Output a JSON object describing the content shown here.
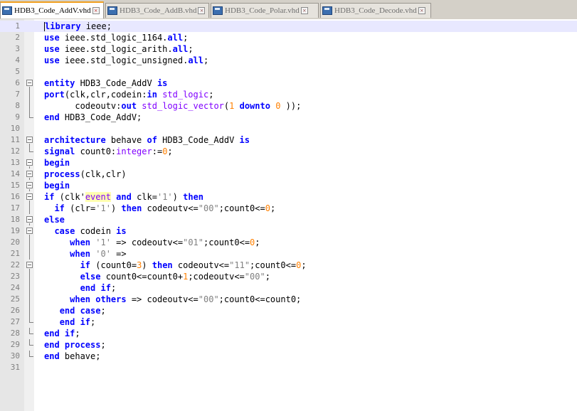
{
  "tabs": [
    {
      "label": "HDB3_Code_AddV.vhd",
      "active": true
    },
    {
      "label": "HDB3_Code_AddB.vhd",
      "active": false
    },
    {
      "label": "HDB3_Code_Polar.vhd",
      "active": false
    },
    {
      "label": "HDB3_Code_Decode.vhd",
      "active": false
    }
  ],
  "line_numbers": [
    "1",
    "2",
    "3",
    "4",
    "5",
    "6",
    "7",
    "8",
    "9",
    "10",
    "11",
    "12",
    "13",
    "14",
    "15",
    "16",
    "17",
    "18",
    "19",
    "20",
    "21",
    "22",
    "23",
    "24",
    "25",
    "26",
    "27",
    "28",
    "29",
    "30",
    "31"
  ],
  "code_lines": [
    [
      {
        "c": "k",
        "v": "library"
      },
      {
        "v": " ieee;"
      }
    ],
    [
      {
        "c": "k",
        "v": "use"
      },
      {
        "v": " ieee.std_logic_1164."
      },
      {
        "c": "k",
        "v": "all"
      },
      {
        "v": ";"
      }
    ],
    [
      {
        "c": "k",
        "v": "use"
      },
      {
        "v": " ieee.std_logic_arith."
      },
      {
        "c": "k",
        "v": "all"
      },
      {
        "v": ";"
      }
    ],
    [
      {
        "c": "k",
        "v": "use"
      },
      {
        "v": " ieee.std_logic_unsigned."
      },
      {
        "c": "k",
        "v": "all"
      },
      {
        "v": ";"
      }
    ],
    [],
    [
      {
        "c": "k",
        "v": "entity"
      },
      {
        "v": " HDB3_Code_AddV "
      },
      {
        "c": "k",
        "v": "is"
      }
    ],
    [
      {
        "c": "k",
        "v": "port"
      },
      {
        "v": "(clk,clr,codein:"
      },
      {
        "c": "k",
        "v": "in"
      },
      {
        "v": " "
      },
      {
        "c": "t",
        "v": "std_logic"
      },
      {
        "v": ";"
      }
    ],
    [
      {
        "v": "      codeoutv:"
      },
      {
        "c": "k",
        "v": "out"
      },
      {
        "v": " "
      },
      {
        "c": "t",
        "v": "std_logic_vector"
      },
      {
        "v": "("
      },
      {
        "c": "n",
        "v": "1"
      },
      {
        "v": " "
      },
      {
        "c": "k",
        "v": "downto"
      },
      {
        "v": " "
      },
      {
        "c": "n",
        "v": "0"
      },
      {
        "v": " ));"
      }
    ],
    [
      {
        "c": "k",
        "v": "end"
      },
      {
        "v": " HDB3_Code_AddV;"
      }
    ],
    [],
    [
      {
        "c": "k",
        "v": "architecture"
      },
      {
        "v": " behave "
      },
      {
        "c": "k",
        "v": "of"
      },
      {
        "v": " HDB3_Code_AddV "
      },
      {
        "c": "k",
        "v": "is"
      }
    ],
    [
      {
        "c": "k",
        "v": "signal"
      },
      {
        "v": " count0:"
      },
      {
        "c": "t",
        "v": "integer"
      },
      {
        "v": ":="
      },
      {
        "c": "n",
        "v": "0"
      },
      {
        "v": ";"
      }
    ],
    [
      {
        "c": "k",
        "v": "begin"
      }
    ],
    [
      {
        "c": "k",
        "v": "process"
      },
      {
        "v": "(clk,clr)"
      }
    ],
    [
      {
        "c": "k",
        "v": "begin"
      }
    ],
    [
      {
        "c": "k",
        "v": "if"
      },
      {
        "v": " (clk'"
      },
      {
        "c": "hl",
        "v": "event"
      },
      {
        "v": " "
      },
      {
        "c": "k",
        "v": "and"
      },
      {
        "v": " clk="
      },
      {
        "c": "s",
        "v": "'1'"
      },
      {
        "v": ") "
      },
      {
        "c": "k",
        "v": "then"
      }
    ],
    [
      {
        "v": "  "
      },
      {
        "c": "k",
        "v": "if"
      },
      {
        "v": " (clr="
      },
      {
        "c": "s",
        "v": "'1'"
      },
      {
        "v": ") "
      },
      {
        "c": "k",
        "v": "then"
      },
      {
        "v": " codeoutv<="
      },
      {
        "c": "s",
        "v": "\"00\""
      },
      {
        "v": ";count0<="
      },
      {
        "c": "n",
        "v": "0"
      },
      {
        "v": ";"
      }
    ],
    [
      {
        "c": "k",
        "v": "else"
      }
    ],
    [
      {
        "v": "  "
      },
      {
        "c": "k",
        "v": "case"
      },
      {
        "v": " codein "
      },
      {
        "c": "k",
        "v": "is"
      }
    ],
    [
      {
        "v": "     "
      },
      {
        "c": "k",
        "v": "when"
      },
      {
        "v": " "
      },
      {
        "c": "s",
        "v": "'1'"
      },
      {
        "v": " => codeoutv<="
      },
      {
        "c": "s",
        "v": "\"01\""
      },
      {
        "v": ";count0<="
      },
      {
        "c": "n",
        "v": "0"
      },
      {
        "v": ";"
      }
    ],
    [
      {
        "v": "     "
      },
      {
        "c": "k",
        "v": "when"
      },
      {
        "v": " "
      },
      {
        "c": "s",
        "v": "'0'"
      },
      {
        "v": " =>"
      }
    ],
    [
      {
        "v": "       "
      },
      {
        "c": "k",
        "v": "if"
      },
      {
        "v": " (count0="
      },
      {
        "c": "n",
        "v": "3"
      },
      {
        "v": ") "
      },
      {
        "c": "k",
        "v": "then"
      },
      {
        "v": " codeoutv<="
      },
      {
        "c": "s",
        "v": "\"11\""
      },
      {
        "v": ";count0<="
      },
      {
        "c": "n",
        "v": "0"
      },
      {
        "v": ";"
      }
    ],
    [
      {
        "v": "       "
      },
      {
        "c": "k",
        "v": "else"
      },
      {
        "v": " count0<=count0+"
      },
      {
        "c": "n",
        "v": "1"
      },
      {
        "v": ";codeoutv<="
      },
      {
        "c": "s",
        "v": "\"00\""
      },
      {
        "v": ";"
      }
    ],
    [
      {
        "v": "       "
      },
      {
        "c": "k",
        "v": "end if"
      },
      {
        "v": ";"
      }
    ],
    [
      {
        "v": "     "
      },
      {
        "c": "k",
        "v": "when others"
      },
      {
        "v": " => codeoutv<="
      },
      {
        "c": "s",
        "v": "\"00\""
      },
      {
        "v": ";count0<=count0;"
      }
    ],
    [
      {
        "v": "   "
      },
      {
        "c": "k",
        "v": "end case"
      },
      {
        "v": ";"
      }
    ],
    [
      {
        "v": "   "
      },
      {
        "c": "k",
        "v": "end if"
      },
      {
        "v": ";"
      }
    ],
    [
      {
        "c": "k",
        "v": "end if"
      },
      {
        "v": ";"
      }
    ],
    [
      {
        "c": "k",
        "v": "end process"
      },
      {
        "v": ";"
      }
    ],
    [
      {
        "c": "k",
        "v": "end"
      },
      {
        "v": " behave;"
      }
    ],
    []
  ],
  "fold_markers": [
    "",
    "",
    "",
    "",
    "",
    "box",
    "line",
    "line",
    "end",
    "",
    "box",
    "end",
    "box",
    "box",
    "box",
    "box",
    "line",
    "box",
    "box",
    "line",
    "line",
    "box",
    "line",
    "line",
    "line",
    "line",
    "end",
    "end",
    "end",
    "end",
    ""
  ],
  "current_line": "1",
  "colors": {
    "keyword": "#0000ff",
    "type": "#8000ff",
    "number": "#ff8000",
    "string": "#808080",
    "gutter": "#e6e6e6",
    "current_line": "#e8e8ff",
    "active_tab_accent": "#f0a020"
  },
  "icons": {
    "file": "vhd-file-icon",
    "close": "tab-close-icon"
  }
}
